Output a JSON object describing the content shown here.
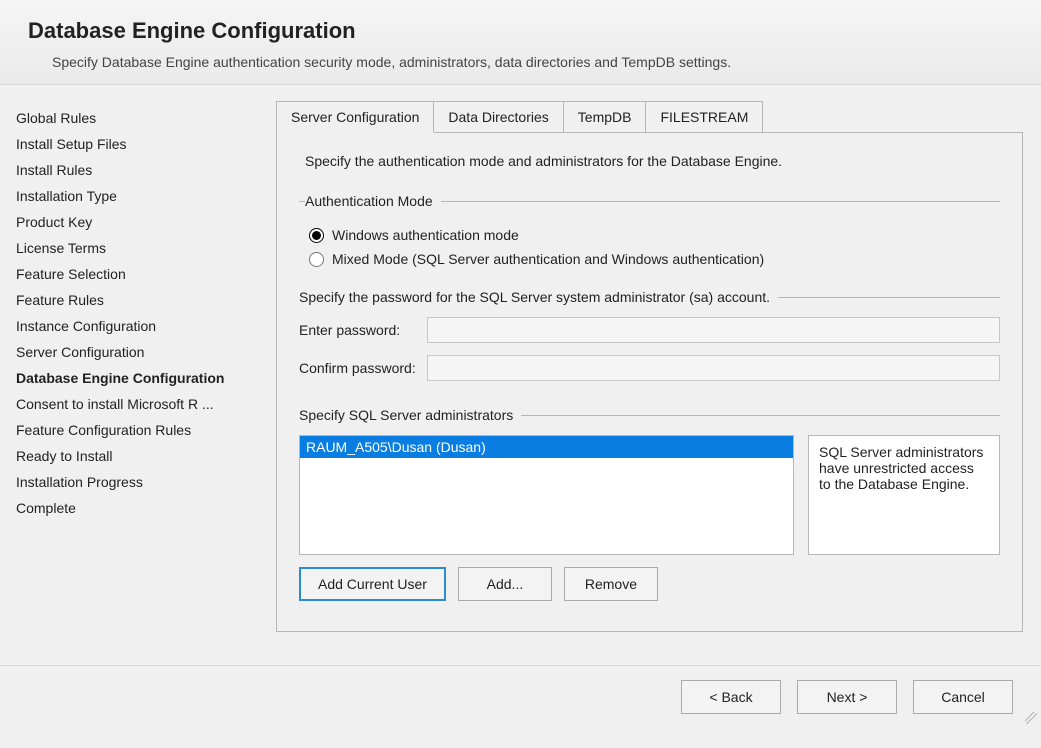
{
  "header": {
    "title": "Database Engine Configuration",
    "subtitle": "Specify Database Engine authentication security mode, administrators, data directories and TempDB settings."
  },
  "sidebar": {
    "items": [
      {
        "label": "Global Rules",
        "current": false
      },
      {
        "label": "Install Setup Files",
        "current": false
      },
      {
        "label": "Install Rules",
        "current": false
      },
      {
        "label": "Installation Type",
        "current": false
      },
      {
        "label": "Product Key",
        "current": false
      },
      {
        "label": "License Terms",
        "current": false
      },
      {
        "label": "Feature Selection",
        "current": false
      },
      {
        "label": "Feature Rules",
        "current": false
      },
      {
        "label": "Instance Configuration",
        "current": false
      },
      {
        "label": "Server Configuration",
        "current": false
      },
      {
        "label": "Database Engine Configuration",
        "current": true
      },
      {
        "label": "Consent to install Microsoft R ...",
        "current": false
      },
      {
        "label": "Feature Configuration Rules",
        "current": false
      },
      {
        "label": "Ready to Install",
        "current": false
      },
      {
        "label": "Installation Progress",
        "current": false
      },
      {
        "label": "Complete",
        "current": false
      }
    ]
  },
  "tabs": [
    {
      "label": "Server Configuration",
      "active": true
    },
    {
      "label": "Data Directories",
      "active": false
    },
    {
      "label": "TempDB",
      "active": false
    },
    {
      "label": "FILESTREAM",
      "active": false
    }
  ],
  "panel": {
    "intro": "Specify the authentication mode and administrators for the Database Engine.",
    "auth_mode_legend": "Authentication Mode",
    "radio_windows": "Windows authentication mode",
    "radio_mixed": "Mixed Mode (SQL Server authentication and Windows authentication)",
    "selected_mode": "windows",
    "sa_legend": "Specify the password for the SQL Server system administrator (sa) account.",
    "enter_password_label": "Enter password:",
    "confirm_password_label": "Confirm password:",
    "enter_password_value": "",
    "confirm_password_value": "",
    "admins_legend": "Specify SQL Server administrators",
    "admin_list": [
      {
        "text": "RAUM_A505\\Dusan (Dusan)",
        "selected": true
      }
    ],
    "admin_info": "SQL Server administrators have unrestricted access to the Database Engine.",
    "btn_add_current": "Add Current User",
    "btn_add": "Add...",
    "btn_remove": "Remove"
  },
  "footer": {
    "back": "< Back",
    "next": "Next >",
    "cancel": "Cancel"
  }
}
